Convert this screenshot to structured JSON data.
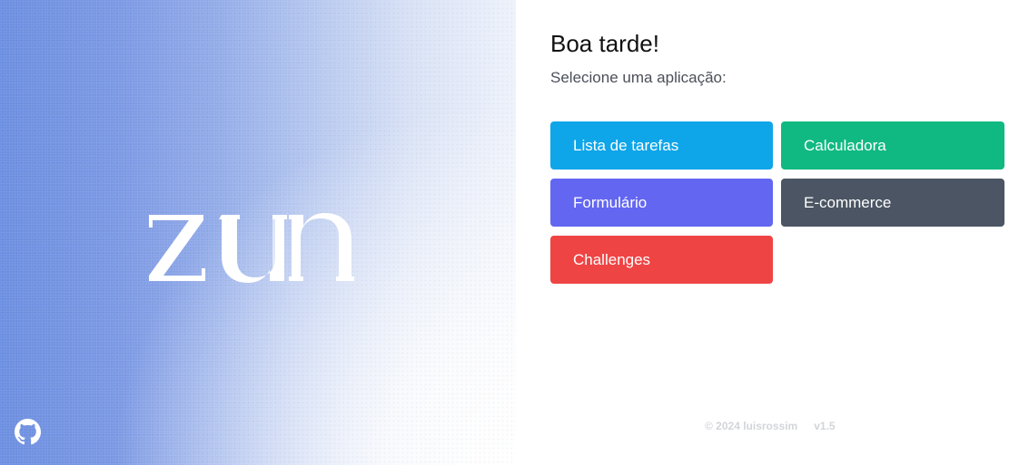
{
  "hero": {
    "logo_text": "zun",
    "github_icon": "github-icon"
  },
  "main": {
    "greeting": "Boa tarde!",
    "subtitle": "Selecione uma aplicação:",
    "apps": [
      {
        "label": "Lista de tarefas",
        "color": "#0ea5e9"
      },
      {
        "label": "Calculadora",
        "color": "#10b981"
      },
      {
        "label": "Formulário",
        "color": "#6366f1"
      },
      {
        "label": "E-commerce",
        "color": "#4b5563"
      },
      {
        "label": "Challenges",
        "color": "#ef4444"
      }
    ]
  },
  "footer": {
    "copyright": "© 2024 luisrossim",
    "version": "v1.5"
  }
}
